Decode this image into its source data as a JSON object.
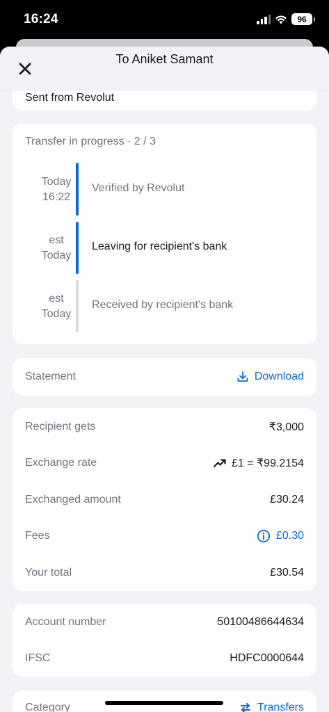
{
  "status_bar": {
    "time": "16:24",
    "battery": "96"
  },
  "header": {
    "title": "To Aniket Samant"
  },
  "sent_card": {
    "text": "Sent from Revolut"
  },
  "progress": {
    "title": "Transfer in progress · 2 / 3",
    "steps": [
      {
        "time_line1": "Today",
        "time_line2": "16:22",
        "label": "Verified by Revolut",
        "state": "done"
      },
      {
        "time_line1": "est",
        "time_line2": "Today",
        "label": "Leaving for recipient's bank",
        "state": "current"
      },
      {
        "time_line1": "est",
        "time_line2": "Today",
        "label": "Received by recipient's bank",
        "state": "pending"
      }
    ]
  },
  "statement": {
    "label": "Statement",
    "action": "Download"
  },
  "details": {
    "recipient_gets": {
      "label": "Recipient gets",
      "value": "₹3,000"
    },
    "exchange_rate": {
      "label": "Exchange rate",
      "value": "£1 = ₹99.2154"
    },
    "exchanged_amount": {
      "label": "Exchanged amount",
      "value": "£30.24"
    },
    "fees": {
      "label": "Fees",
      "value": "£0.30"
    },
    "your_total": {
      "label": "Your total",
      "value": "£30.54"
    }
  },
  "account": {
    "account_number": {
      "label": "Account number",
      "value": "50100486644634"
    },
    "ifsc": {
      "label": "IFSC",
      "value": "HDFC0000644"
    }
  },
  "category": {
    "label": "Category",
    "value": "Transfers"
  },
  "colors": {
    "accent": "#0b6ad1",
    "progress_active": "#0b6ad1",
    "progress_pending": "#d9dadf",
    "background": "#f2f3f6"
  }
}
